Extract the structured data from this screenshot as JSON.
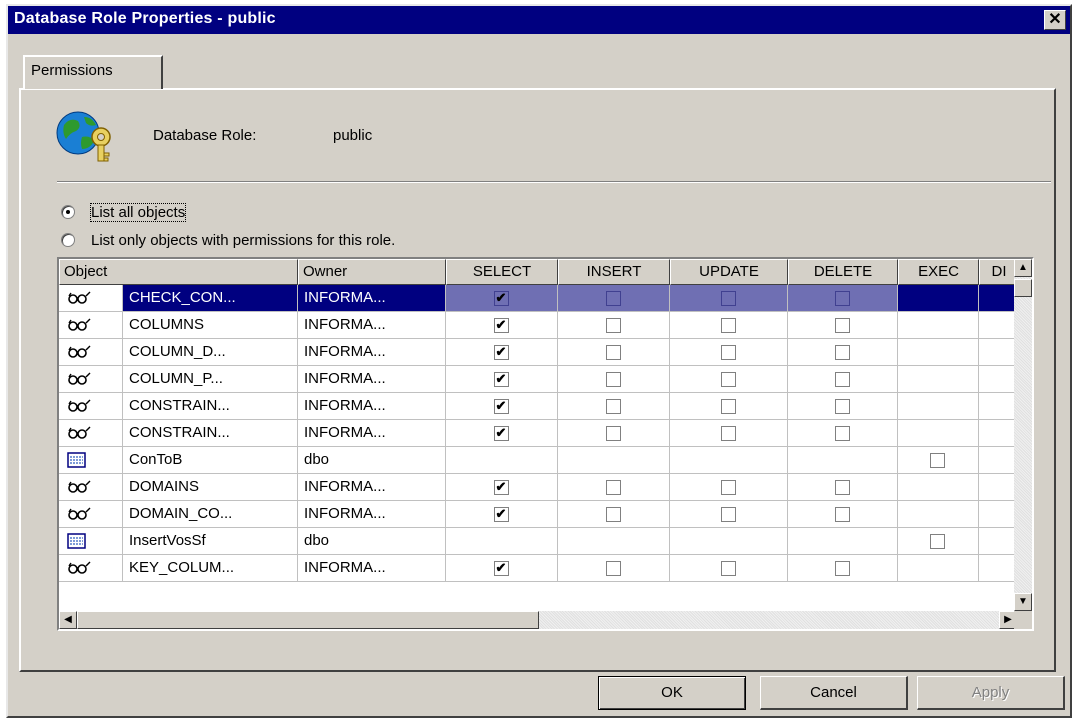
{
  "window": {
    "title": "Database Role Properties - public",
    "close_glyph": "✕"
  },
  "tabs": [
    {
      "label": "Permissions",
      "selected": true
    }
  ],
  "role": {
    "label": "Database Role:",
    "value": "public",
    "icon": "globe-key-icon"
  },
  "options": {
    "list_all": "List all objects",
    "list_only": "List only objects with permissions for this role.",
    "selected": "list_all"
  },
  "grid": {
    "columns": [
      "Object",
      "Owner",
      "SELECT",
      "INSERT",
      "UPDATE",
      "DELETE",
      "EXEC",
      "DI"
    ],
    "rows": [
      {
        "type": "view",
        "name": "CHECK_CON...",
        "owner": "INFORMA...",
        "select": true,
        "insert": false,
        "update": false,
        "delete": false,
        "exec": null,
        "selected": true
      },
      {
        "type": "view",
        "name": "COLUMNS",
        "owner": "INFORMA...",
        "select": true,
        "insert": false,
        "update": false,
        "delete": false,
        "exec": null
      },
      {
        "type": "view",
        "name": "COLUMN_D...",
        "owner": "INFORMA...",
        "select": true,
        "insert": false,
        "update": false,
        "delete": false,
        "exec": null
      },
      {
        "type": "view",
        "name": "COLUMN_P...",
        "owner": "INFORMA...",
        "select": true,
        "insert": false,
        "update": false,
        "delete": false,
        "exec": null
      },
      {
        "type": "view",
        "name": "CONSTRAIN...",
        "owner": "INFORMA...",
        "select": true,
        "insert": false,
        "update": false,
        "delete": false,
        "exec": null
      },
      {
        "type": "view",
        "name": "CONSTRAIN...",
        "owner": "INFORMA...",
        "select": true,
        "insert": false,
        "update": false,
        "delete": false,
        "exec": null
      },
      {
        "type": "proc",
        "name": "ConToB",
        "owner": "dbo",
        "select": null,
        "insert": null,
        "update": null,
        "delete": null,
        "exec": false
      },
      {
        "type": "view",
        "name": "DOMAINS",
        "owner": "INFORMA...",
        "select": true,
        "insert": false,
        "update": false,
        "delete": false,
        "exec": null
      },
      {
        "type": "view",
        "name": "DOMAIN_CO...",
        "owner": "INFORMA...",
        "select": true,
        "insert": false,
        "update": false,
        "delete": false,
        "exec": null
      },
      {
        "type": "proc",
        "name": "InsertVosSf",
        "owner": "dbo",
        "select": null,
        "insert": null,
        "update": null,
        "delete": null,
        "exec": false
      },
      {
        "type": "view",
        "name": "KEY_COLUM...",
        "owner": "INFORMA...",
        "select": true,
        "insert": false,
        "update": false,
        "delete": false,
        "exec": null
      }
    ]
  },
  "buttons": {
    "ok": "OK",
    "cancel": "Cancel",
    "apply": "Apply"
  },
  "colors": {
    "titlebar": "#000080",
    "selection": "#000080",
    "face": "#d4d0c8"
  }
}
